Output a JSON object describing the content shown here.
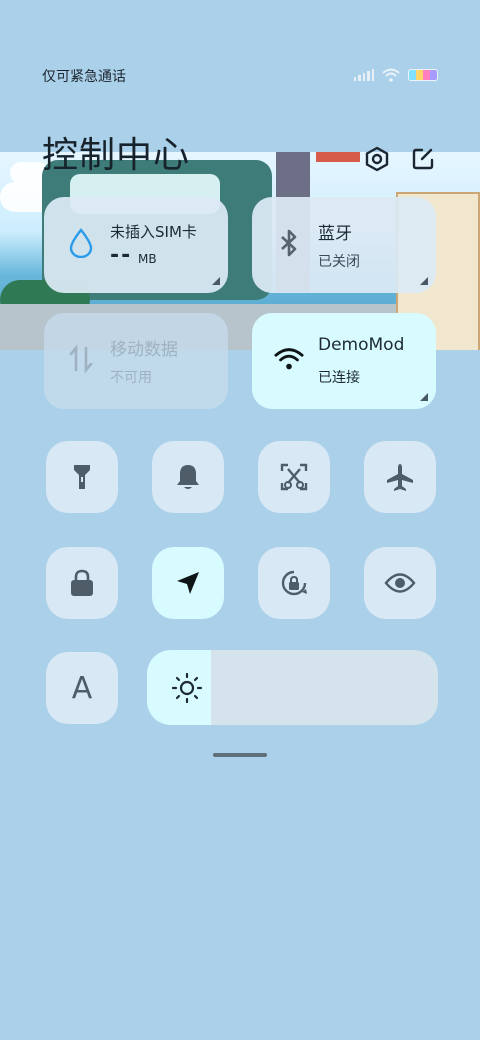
{
  "status_bar": {
    "carrier_text": "仅可紧急通话"
  },
  "header": {
    "title": "控制中心",
    "settings_icon": "settings-icon",
    "edit_icon": "edit-icon"
  },
  "cards": {
    "sim": {
      "label": "未插入SIM卡",
      "value": "--",
      "unit": "MB"
    },
    "bluetooth": {
      "label": "蓝牙",
      "status": "已关闭"
    },
    "mobile_data": {
      "label": "移动数据",
      "status": "不可用"
    },
    "wifi": {
      "label": "DemoMod",
      "status": "已连接"
    }
  },
  "toggles": [
    {
      "name": "flashlight",
      "active": false
    },
    {
      "name": "mute",
      "active": false
    },
    {
      "name": "screenshot",
      "active": false
    },
    {
      "name": "airplane-mode",
      "active": false
    },
    {
      "name": "lock-screen",
      "active": false
    },
    {
      "name": "location",
      "active": true
    },
    {
      "name": "rotation-lock",
      "active": false
    },
    {
      "name": "eye-comfort",
      "active": false
    },
    {
      "name": "font-size",
      "active": false,
      "label": "A"
    }
  ],
  "brightness": {
    "level_fraction": 0.22
  },
  "colors": {
    "background": "#abd0e9",
    "tile": "#dceaf4",
    "active_tile": "#d8fbff",
    "text": "#1d2a33"
  }
}
